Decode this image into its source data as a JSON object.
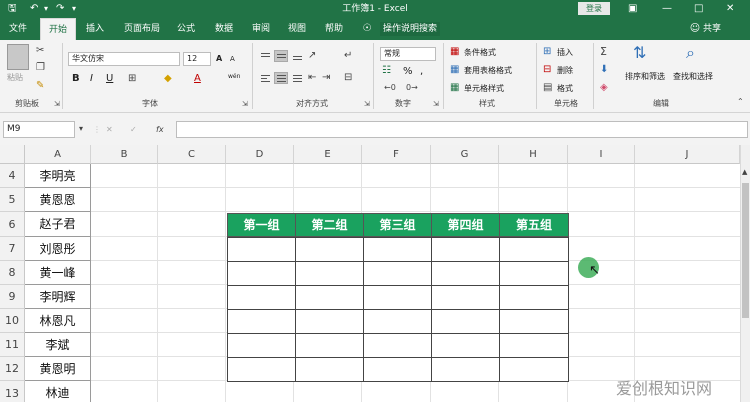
{
  "titlebar": {
    "title": "工作簿1 - Excel",
    "login": "登录",
    "save_icon": "save-icon",
    "undo_icon": "undo-icon",
    "redo_icon": "redo-icon",
    "bg_color": "#217346"
  },
  "menu": {
    "tabs": [
      "文件",
      "开始",
      "插入",
      "页面布局",
      "公式",
      "数据",
      "审阅",
      "视图",
      "帮助"
    ],
    "active": "开始",
    "tell_me": "操作说明搜索",
    "share": "共享"
  },
  "ribbon": {
    "clipboard": {
      "paste": "粘贴",
      "label": "剪贴板"
    },
    "font": {
      "name": "华文仿宋",
      "size": "12",
      "bold": "B",
      "italic": "I",
      "underline": "U",
      "grow": "A",
      "shrink": "A",
      "wen": "wén",
      "label": "字体"
    },
    "alignment": {
      "label": "对齐方式"
    },
    "number": {
      "format": "常规",
      "percent": "%",
      "comma": ",",
      "label": "数字"
    },
    "styles": {
      "conditional": "条件格式",
      "table": "套用表格格式",
      "cell": "单元格样式",
      "label": "样式"
    },
    "cells": {
      "insert": "插入",
      "delete": "删除",
      "format": "格式",
      "label": "单元格"
    },
    "editing": {
      "sort": "排序和筛选",
      "find": "查找和选择",
      "label": "编辑"
    }
  },
  "formula": {
    "namebox": "M9",
    "cancel": "✕",
    "enter": "✓",
    "fx": "fx",
    "content": ""
  },
  "sheet": {
    "columns": [
      "A",
      "B",
      "C",
      "D",
      "E",
      "F",
      "G",
      "H",
      "I",
      "J"
    ],
    "rows": [
      "4",
      "5",
      "6",
      "7",
      "8",
      "9",
      "10",
      "11",
      "12",
      "13"
    ],
    "names": [
      "李明亮",
      "黄恩恩",
      "赵子君",
      "刘恩彤",
      "黄一峰",
      "李明辉",
      "林恩凡",
      "李斌",
      "黄恩明",
      "林迪"
    ],
    "table_headers": [
      "第一组",
      "第二组",
      "第三组",
      "第四组",
      "第五组"
    ],
    "header_color": "#1aa25f"
  },
  "watermark": "爱创根知识网"
}
